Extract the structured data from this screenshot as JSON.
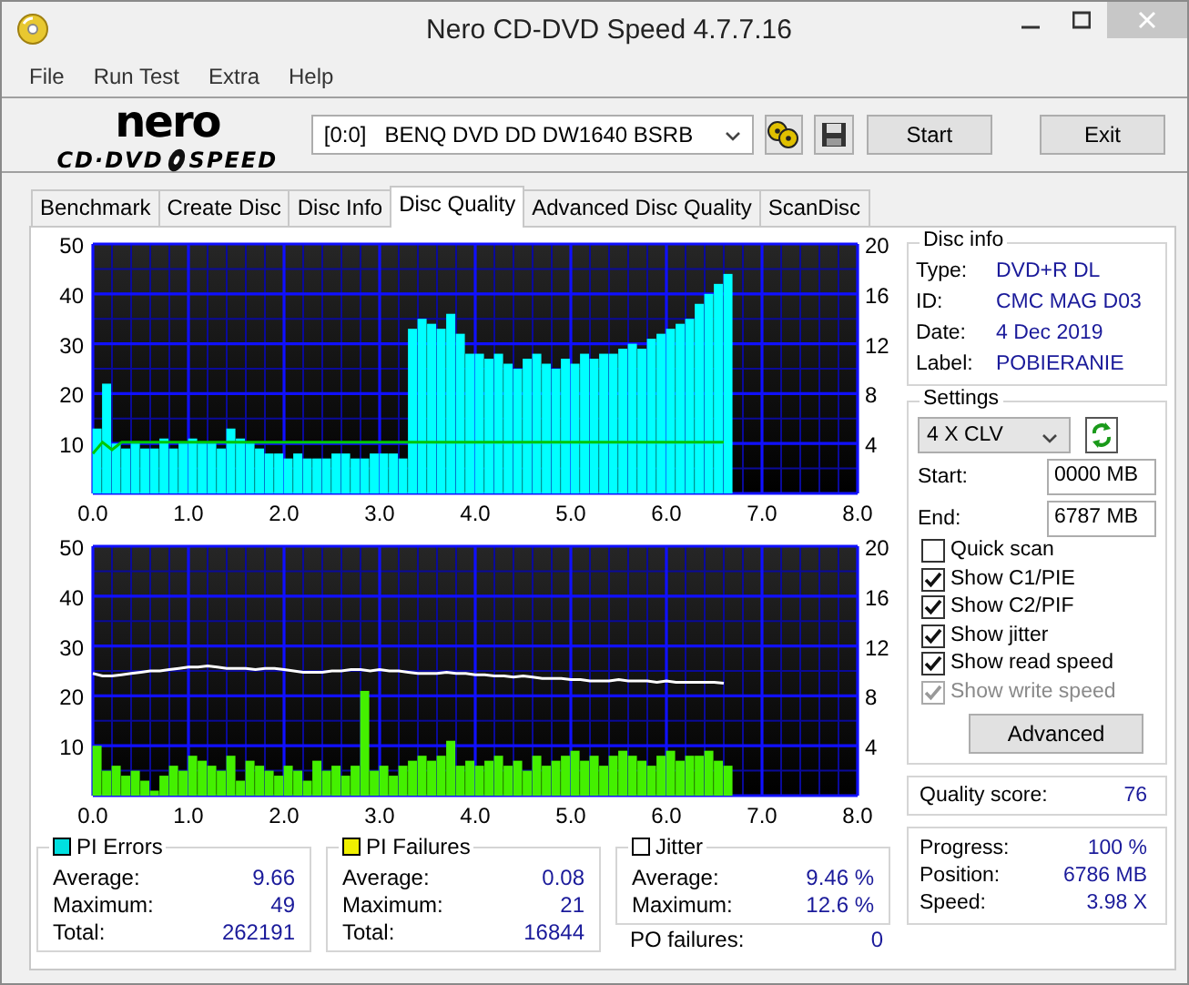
{
  "window": {
    "title": "Nero CD-DVD Speed 4.7.7.16"
  },
  "menu": [
    "File",
    "Run Test",
    "Extra",
    "Help"
  ],
  "logo": {
    "brand": "nero",
    "product_left": "CD·DVD",
    "product_right": "SPEED"
  },
  "drive": {
    "port": "[0:0]",
    "name": "BENQ DVD DD DW1640 BSRB"
  },
  "buttons": [
    "Start",
    "Exit"
  ],
  "tabs": [
    {
      "label": "Benchmark",
      "selected": false
    },
    {
      "label": "Create Disc",
      "selected": false
    },
    {
      "label": "Disc Info",
      "selected": false
    },
    {
      "label": "Disc Quality",
      "selected": true
    },
    {
      "label": "Advanced Disc Quality",
      "selected": false
    },
    {
      "label": "ScanDisc",
      "selected": false
    }
  ],
  "charts": [
    {
      "chart_data": {
        "type": "bar",
        "grid": true,
        "xlim": [
          0,
          8
        ],
        "ylim": [
          0,
          50
        ],
        "y2lim": [
          0,
          20
        ],
        "xticks": [
          {
            "value": 0,
            "label": "0.0"
          },
          {
            "value": 1,
            "label": "1.0"
          },
          {
            "value": 2,
            "label": "2.0"
          },
          {
            "value": 3,
            "label": "3.0"
          },
          {
            "value": 4,
            "label": "4.0"
          },
          {
            "value": 5,
            "label": "5.0"
          },
          {
            "value": 6,
            "label": "6.0"
          },
          {
            "value": 7,
            "label": "7.0"
          },
          {
            "value": 8,
            "label": "8.0"
          }
        ],
        "yticks": [
          10,
          20,
          30,
          40,
          50
        ],
        "y2ticks": [
          4,
          8,
          12,
          16,
          20
        ],
        "x": [
          0,
          0.1,
          0.2,
          0.3,
          0.4,
          0.5,
          0.6,
          0.7,
          0.8,
          0.9,
          1,
          1.1,
          1.2,
          1.3,
          1.4,
          1.5,
          1.6,
          1.7,
          1.8,
          1.9,
          2,
          2.1,
          2.2,
          2.3,
          2.4,
          2.5,
          2.6,
          2.7,
          2.8,
          2.9,
          3,
          3.1,
          3.2,
          3.3,
          3.4,
          3.5,
          3.6,
          3.7,
          3.8,
          3.9,
          4,
          4.1,
          4.2,
          4.3,
          4.4,
          4.5,
          4.6,
          4.7,
          4.8,
          4.9,
          5,
          5.1,
          5.2,
          5.3,
          5.4,
          5.5,
          5.6,
          5.7,
          5.8,
          5.9,
          6,
          6.1,
          6.2,
          6.3,
          6.4,
          6.5,
          6.6
        ],
        "series": [
          {
            "color": "#00ffff",
            "values": [
              13,
              22,
              10,
              9,
              10,
              9,
              9,
              11,
              9,
              10,
              11,
              10,
              10,
              9,
              13,
              11,
              10,
              9,
              8,
              8,
              7,
              8,
              7,
              7,
              7,
              8,
              8,
              7,
              7,
              8,
              8,
              8,
              7,
              33,
              35,
              34,
              33,
              36,
              32,
              28,
              28,
              27,
              28,
              26,
              25,
              27,
              28,
              26,
              25,
              27,
              26,
              28,
              27,
              28,
              28,
              29,
              30,
              29,
              31,
              32,
              33,
              34,
              35,
              38,
              40,
              42,
              44
            ]
          },
          {
            "color": "#00c800",
            "axis": "y2",
            "type": "line",
            "values": [
              3.2,
              4.1,
              3.5,
              4.1,
              4.1,
              4.1,
              4.1,
              4.1,
              4.1,
              4.1,
              4.1,
              4.1,
              4.1,
              4.1,
              4.1,
              4.1,
              4.1,
              4.1,
              4.1,
              4.1,
              4.1,
              4.1,
              4.1,
              4.1,
              4.1,
              4.1,
              4.1,
              4.1,
              4.1,
              4.1,
              4.1,
              4.1,
              4.1,
              4.1,
              4.1,
              4.1,
              4.1,
              4.1,
              4.1,
              4.1,
              4.1,
              4.1,
              4.1,
              4.1,
              4.1,
              4.1,
              4.1,
              4.1,
              4.1,
              4.1,
              4.1,
              4.1,
              4.1,
              4.1,
              4.1,
              4.1,
              4.1,
              4.1,
              4.1,
              4.1,
              4.1,
              4.1,
              4.1,
              4.1,
              4.1,
              4.1,
              4.1
            ]
          }
        ]
      }
    },
    {
      "chart_data": {
        "type": "bar",
        "grid": true,
        "xlim": [
          0,
          8
        ],
        "ylim": [
          0,
          50
        ],
        "y2lim": [
          0,
          20
        ],
        "xticks": [
          {
            "value": 0,
            "label": "0.0"
          },
          {
            "value": 1,
            "label": "1.0"
          },
          {
            "value": 2,
            "label": "2.0"
          },
          {
            "value": 3,
            "label": "3.0"
          },
          {
            "value": 4,
            "label": "4.0"
          },
          {
            "value": 5,
            "label": "5.0"
          },
          {
            "value": 6,
            "label": "6.0"
          },
          {
            "value": 7,
            "label": "7.0"
          },
          {
            "value": 8,
            "label": "8.0"
          }
        ],
        "yticks": [
          10,
          20,
          30,
          40,
          50
        ],
        "y2ticks": [
          4,
          8,
          12,
          16,
          20
        ],
        "x": [
          0,
          0.1,
          0.2,
          0.3,
          0.4,
          0.5,
          0.6,
          0.7,
          0.8,
          0.9,
          1,
          1.1,
          1.2,
          1.3,
          1.4,
          1.5,
          1.6,
          1.7,
          1.8,
          1.9,
          2,
          2.1,
          2.2,
          2.3,
          2.4,
          2.5,
          2.6,
          2.7,
          2.8,
          2.9,
          3,
          3.1,
          3.2,
          3.3,
          3.4,
          3.5,
          3.6,
          3.7,
          3.8,
          3.9,
          4,
          4.1,
          4.2,
          4.3,
          4.4,
          4.5,
          4.6,
          4.7,
          4.8,
          4.9,
          5,
          5.1,
          5.2,
          5.3,
          5.4,
          5.5,
          5.6,
          5.7,
          5.8,
          5.9,
          6,
          6.1,
          6.2,
          6.3,
          6.4,
          6.5,
          6.6
        ],
        "series": [
          {
            "color": "#44f000",
            "values": [
              10,
              5,
              6,
              4,
              5,
              3,
              1,
              4,
              6,
              5,
              8,
              7,
              6,
              5,
              8,
              3,
              7,
              6,
              5,
              4,
              6,
              5,
              3,
              7,
              5,
              6,
              4,
              6,
              21,
              5,
              6,
              4,
              6,
              7,
              8,
              7,
              8,
              11,
              6,
              7,
              6,
              7,
              8,
              6,
              7,
              5,
              8,
              6,
              7,
              8,
              9,
              7,
              8,
              6,
              8,
              9,
              8,
              7,
              6,
              8,
              9,
              7,
              8,
              8,
              9,
              7,
              6
            ]
          },
          {
            "color": "#ffffff",
            "axis": "y2",
            "type": "line",
            "values": [
              9.8,
              9.6,
              9.6,
              9.7,
              9.8,
              9.9,
              10,
              10,
              10.1,
              10.2,
              10.3,
              10.3,
              10.4,
              10.3,
              10.2,
              10.2,
              10.2,
              10.1,
              10.2,
              10.2,
              10.1,
              10,
              9.9,
              9.9,
              9.9,
              10,
              10,
              10.1,
              10.1,
              10,
              10.1,
              10,
              10,
              9.9,
              9.8,
              9.8,
              9.8,
              9.9,
              9.8,
              9.8,
              9.7,
              9.7,
              9.6,
              9.6,
              9.5,
              9.6,
              9.5,
              9.4,
              9.4,
              9.4,
              9.3,
              9.3,
              9.2,
              9.2,
              9.2,
              9.3,
              9.2,
              9.2,
              9.2,
              9.1,
              9.2,
              9.1,
              9.1,
              9.1,
              9.1,
              9.1,
              9.0
            ]
          }
        ]
      }
    }
  ],
  "stats": [
    {
      "title": "PI Errors",
      "color": "#00e0e0",
      "rows": [
        {
          "label": "Average:",
          "value": "9.66"
        },
        {
          "label": "Maximum:",
          "value": "49"
        },
        {
          "label": "Total:",
          "value": "262191"
        }
      ]
    },
    {
      "title": "PI Failures",
      "color": "#f0f000",
      "rows": [
        {
          "label": "Average:",
          "value": "0.08"
        },
        {
          "label": "Maximum:",
          "value": "21"
        },
        {
          "label": "Total:",
          "value": "16844"
        }
      ]
    },
    {
      "title": "Jitter",
      "color": "#ffffff",
      "rows": [
        {
          "label": "Average:",
          "value": "9.46 %"
        },
        {
          "label": "Maximum:",
          "value": "12.6 %"
        }
      ]
    }
  ],
  "po_failures": {
    "label": "PO failures:",
    "value": "0"
  },
  "disc_info": {
    "title": "Disc info",
    "rows": [
      {
        "label": "Type:",
        "value": "DVD+R DL"
      },
      {
        "label": "ID:",
        "value": "CMC MAG D03"
      },
      {
        "label": "Date:",
        "value": "4 Dec 2019"
      },
      {
        "label": "Label:",
        "value": "POBIERANIE"
      }
    ]
  },
  "settings": {
    "title": "Settings",
    "speed": "4 X CLV",
    "start_label": "Start:",
    "start": "0000 MB",
    "end_label": "End:",
    "end": "6787 MB",
    "options": [
      {
        "label": "Quick scan",
        "checked": false,
        "disabled": false
      },
      {
        "label": "Show C1/PIE",
        "checked": true,
        "disabled": false
      },
      {
        "label": "Show C2/PIF",
        "checked": true,
        "disabled": false
      },
      {
        "label": "Show jitter",
        "checked": true,
        "disabled": false
      },
      {
        "label": "Show read speed",
        "checked": true,
        "disabled": false
      },
      {
        "label": "Show write speed",
        "checked": true,
        "disabled": true
      }
    ],
    "advanced": "Advanced"
  },
  "quality": {
    "label": "Quality score:",
    "value": "76"
  },
  "progress": [
    {
      "label": "Progress:",
      "value": "100 %"
    },
    {
      "label": "Position:",
      "value": "6786 MB"
    },
    {
      "label": "Speed:",
      "value": "3.98 X"
    }
  ]
}
